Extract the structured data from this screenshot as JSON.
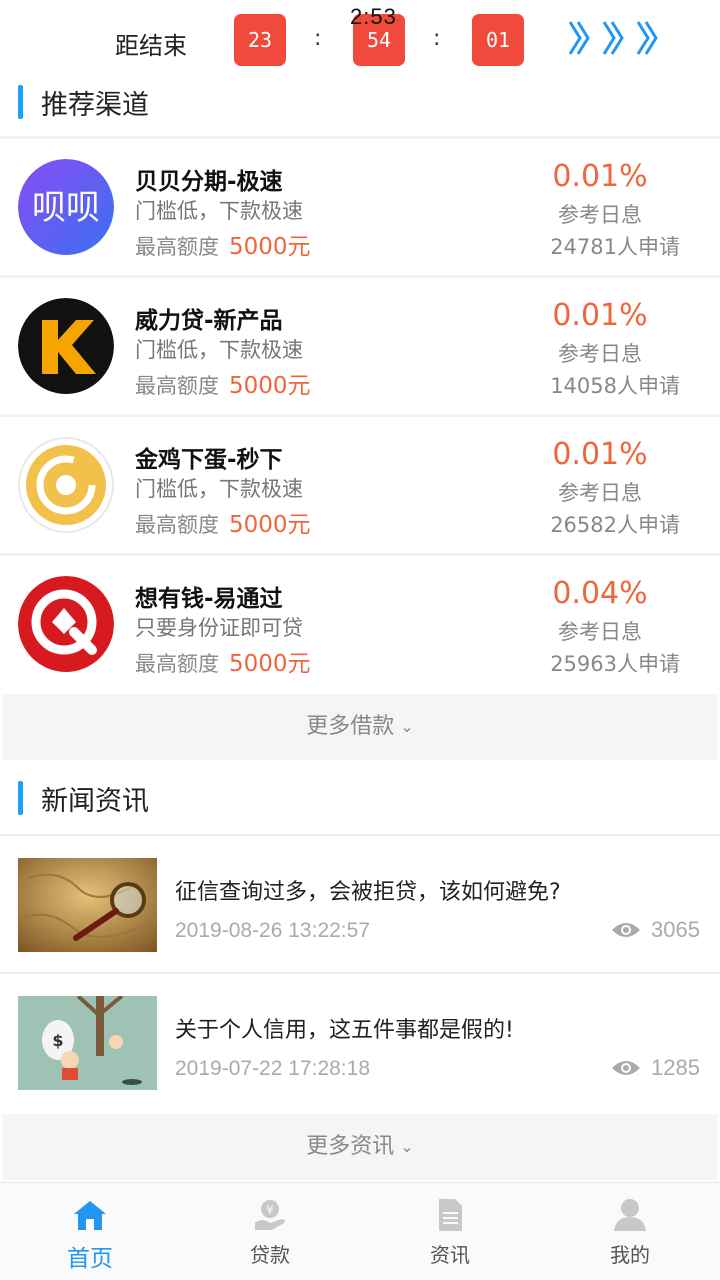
{
  "status": {
    "time": "2:53"
  },
  "countdown": {
    "label": "距结束",
    "hours": "23",
    "minutes": "54",
    "seconds": "01",
    "separator": ":"
  },
  "recommend": {
    "title": "推荐渠道",
    "limit_label": "最高额度",
    "rate_label": "参考日息",
    "channels": [
      {
        "name": "贝贝分期-极速",
        "desc": "门槛低，下款极速",
        "amount": "5000元",
        "rate": "0.01%",
        "applies": "24781人申请",
        "logo_text": "呗呗"
      },
      {
        "name": "威力贷-新产品",
        "desc": "门槛低，下款极速",
        "amount": "5000元",
        "rate": "0.01%",
        "applies": "14058人申请",
        "logo_text": "K"
      },
      {
        "name": "金鸡下蛋-秒下",
        "desc": "门槛低，下款极速",
        "amount": "5000元",
        "rate": "0.01%",
        "applies": "26582人申请"
      },
      {
        "name": "想有钱-易通过",
        "desc": "只要身份证即可贷",
        "amount": "5000元",
        "rate": "0.04%",
        "applies": "25963人申请"
      }
    ],
    "more_label": "更多借款"
  },
  "news": {
    "title": "新闻资讯",
    "items": [
      {
        "title": "征信查询过多，会被拒贷，该如何避免?",
        "date": "2019-08-26 13:22:57",
        "views": "3065"
      },
      {
        "title": "关于个人信用，这五件事都是假的!",
        "date": "2019-07-22 17:28:18",
        "views": "1285"
      }
    ],
    "more_label": "更多资讯"
  },
  "tabbar": {
    "tabs": [
      {
        "label": "首页",
        "icon": "home-icon",
        "active": true
      },
      {
        "label": "贷款",
        "icon": "loan-icon"
      },
      {
        "label": "资讯",
        "icon": "document-icon"
      },
      {
        "label": "我的",
        "icon": "user-icon"
      }
    ]
  },
  "colors": {
    "accent": "#1da1f2",
    "orange": "#f0663c",
    "countdown_red": "#f04a3c",
    "active_tab": "#2196f3"
  }
}
